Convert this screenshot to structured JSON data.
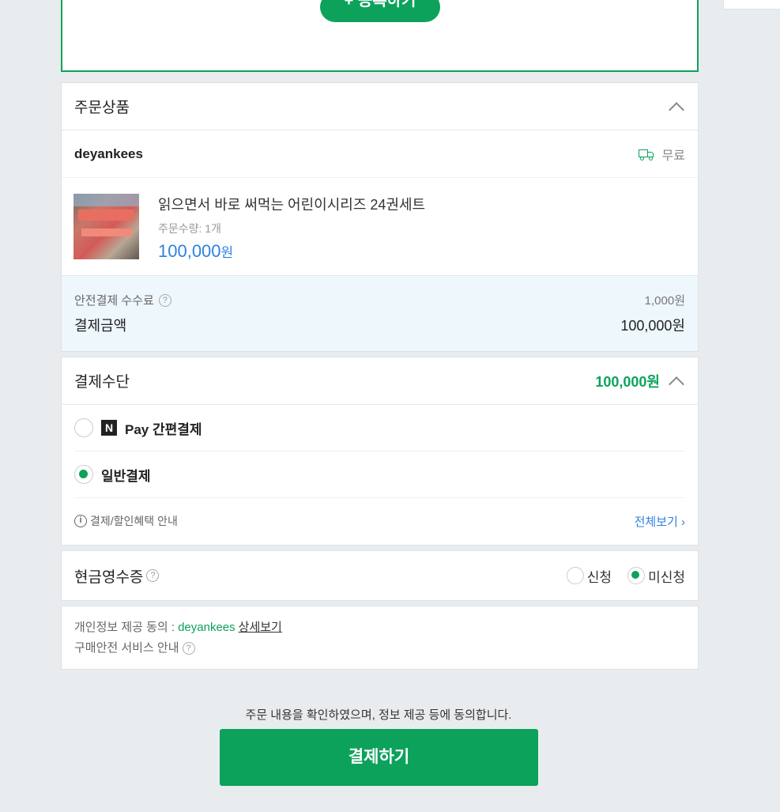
{
  "register_button": {
    "label": "+ 등록하기"
  },
  "order": {
    "title": "주문상품",
    "seller": "deyankees",
    "shipping": "무료",
    "product": {
      "name": "읽으면서 바로 써먹는 어린이시리즈 24권세트",
      "quantity": "주문수량: 1개",
      "price": "100,000",
      "currency": "원"
    },
    "fee_label": "안전결제 수수료",
    "fee_value": "1,000원",
    "total_label": "결제금액",
    "total_value": "100,000원"
  },
  "payment": {
    "title": "결제수단",
    "amount": "100,000원",
    "options": [
      {
        "label": "Pay 간편결제",
        "selected": false
      },
      {
        "label": "일반결제",
        "selected": true
      }
    ],
    "info_label": "결제/할인혜택 안내",
    "view_all": "전체보기 ›"
  },
  "cash_receipt": {
    "title": "현금영수증",
    "options": [
      {
        "label": "신청",
        "selected": false
      },
      {
        "label": "미신청",
        "selected": true
      }
    ]
  },
  "agreement": {
    "privacy_prefix": "개인정보 제공 동의 :",
    "privacy_seller": "deyankees",
    "privacy_detail": "상세보기",
    "safe_service": "구매안전 서비스 안내"
  },
  "confirm_text": "주문 내용을 확인하였으며, 정보 제공 등에 동의합니다.",
  "pay_button": "결제하기",
  "colors": {
    "accent": "#0ca25c",
    "price_blue": "#2d82e0",
    "fee_bg": "#eef7fc"
  },
  "icons": [
    "truck-icon",
    "question-icon",
    "chevron-up-icon",
    "naver-pay-icon",
    "info-icon"
  ]
}
